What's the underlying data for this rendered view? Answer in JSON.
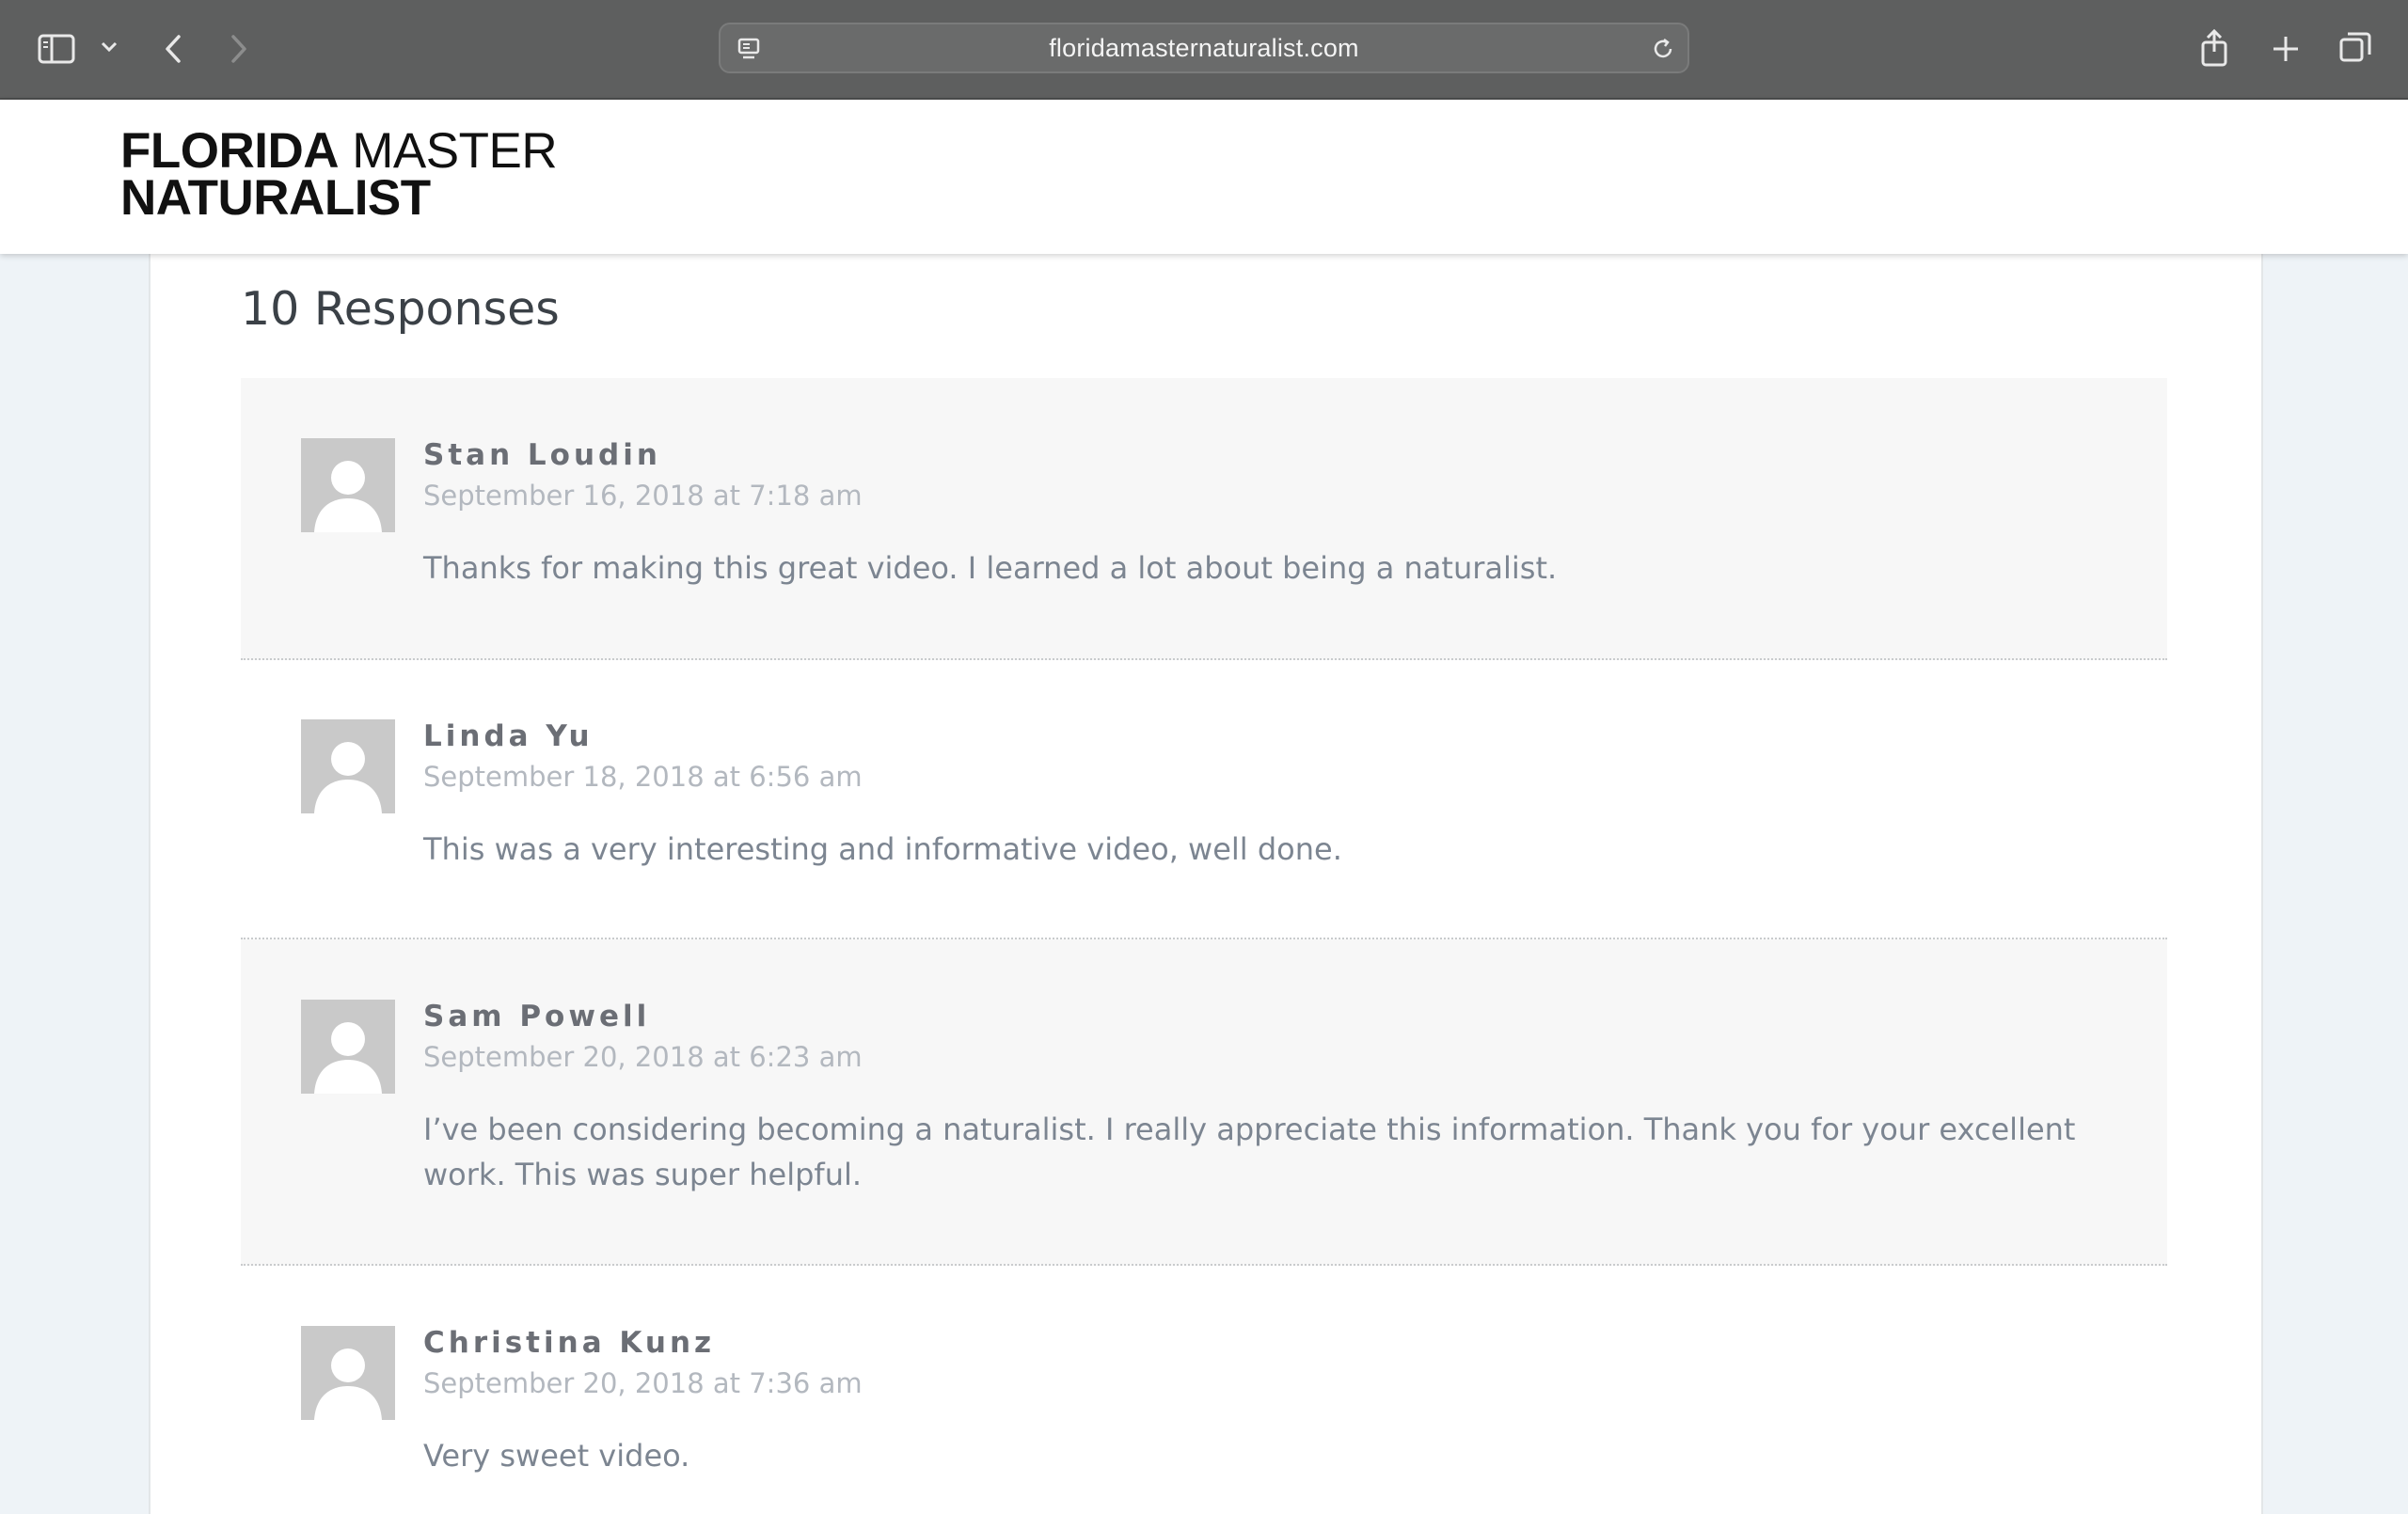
{
  "browser": {
    "url": "floridamasternaturalist.com",
    "icons": [
      "sidebar-icon",
      "chevron-down-icon",
      "back-icon",
      "forward-icon",
      "page-settings-icon",
      "reload-icon",
      "share-icon",
      "new-tab-icon",
      "tab-overview-icon"
    ]
  },
  "site": {
    "logo_bold_1": "FLORIDA",
    "logo_light_1": " MASTER",
    "logo_bold_2": "NATURALIST"
  },
  "responses": {
    "title": "10 Responses",
    "comments": [
      {
        "author": "Stan Loudin",
        "date": "September 16, 2018 at 7:18 am",
        "text": "Thanks for making this great video. I learned a lot about being a naturalist."
      },
      {
        "author": "Linda Yu",
        "date": "September 18, 2018 at 6:56 am",
        "text": "This was a very interesting and informative video, well done."
      },
      {
        "author": "Sam Powell",
        "date": "September 20, 2018 at 6:23 am",
        "text": "I’ve been considering becoming a naturalist. I really appreciate this information. Thank you for your excellent work. This was super helpful."
      },
      {
        "author": "Christina Kunz",
        "date": "September 20, 2018 at 7:36 am",
        "text": "Very sweet video."
      }
    ]
  }
}
